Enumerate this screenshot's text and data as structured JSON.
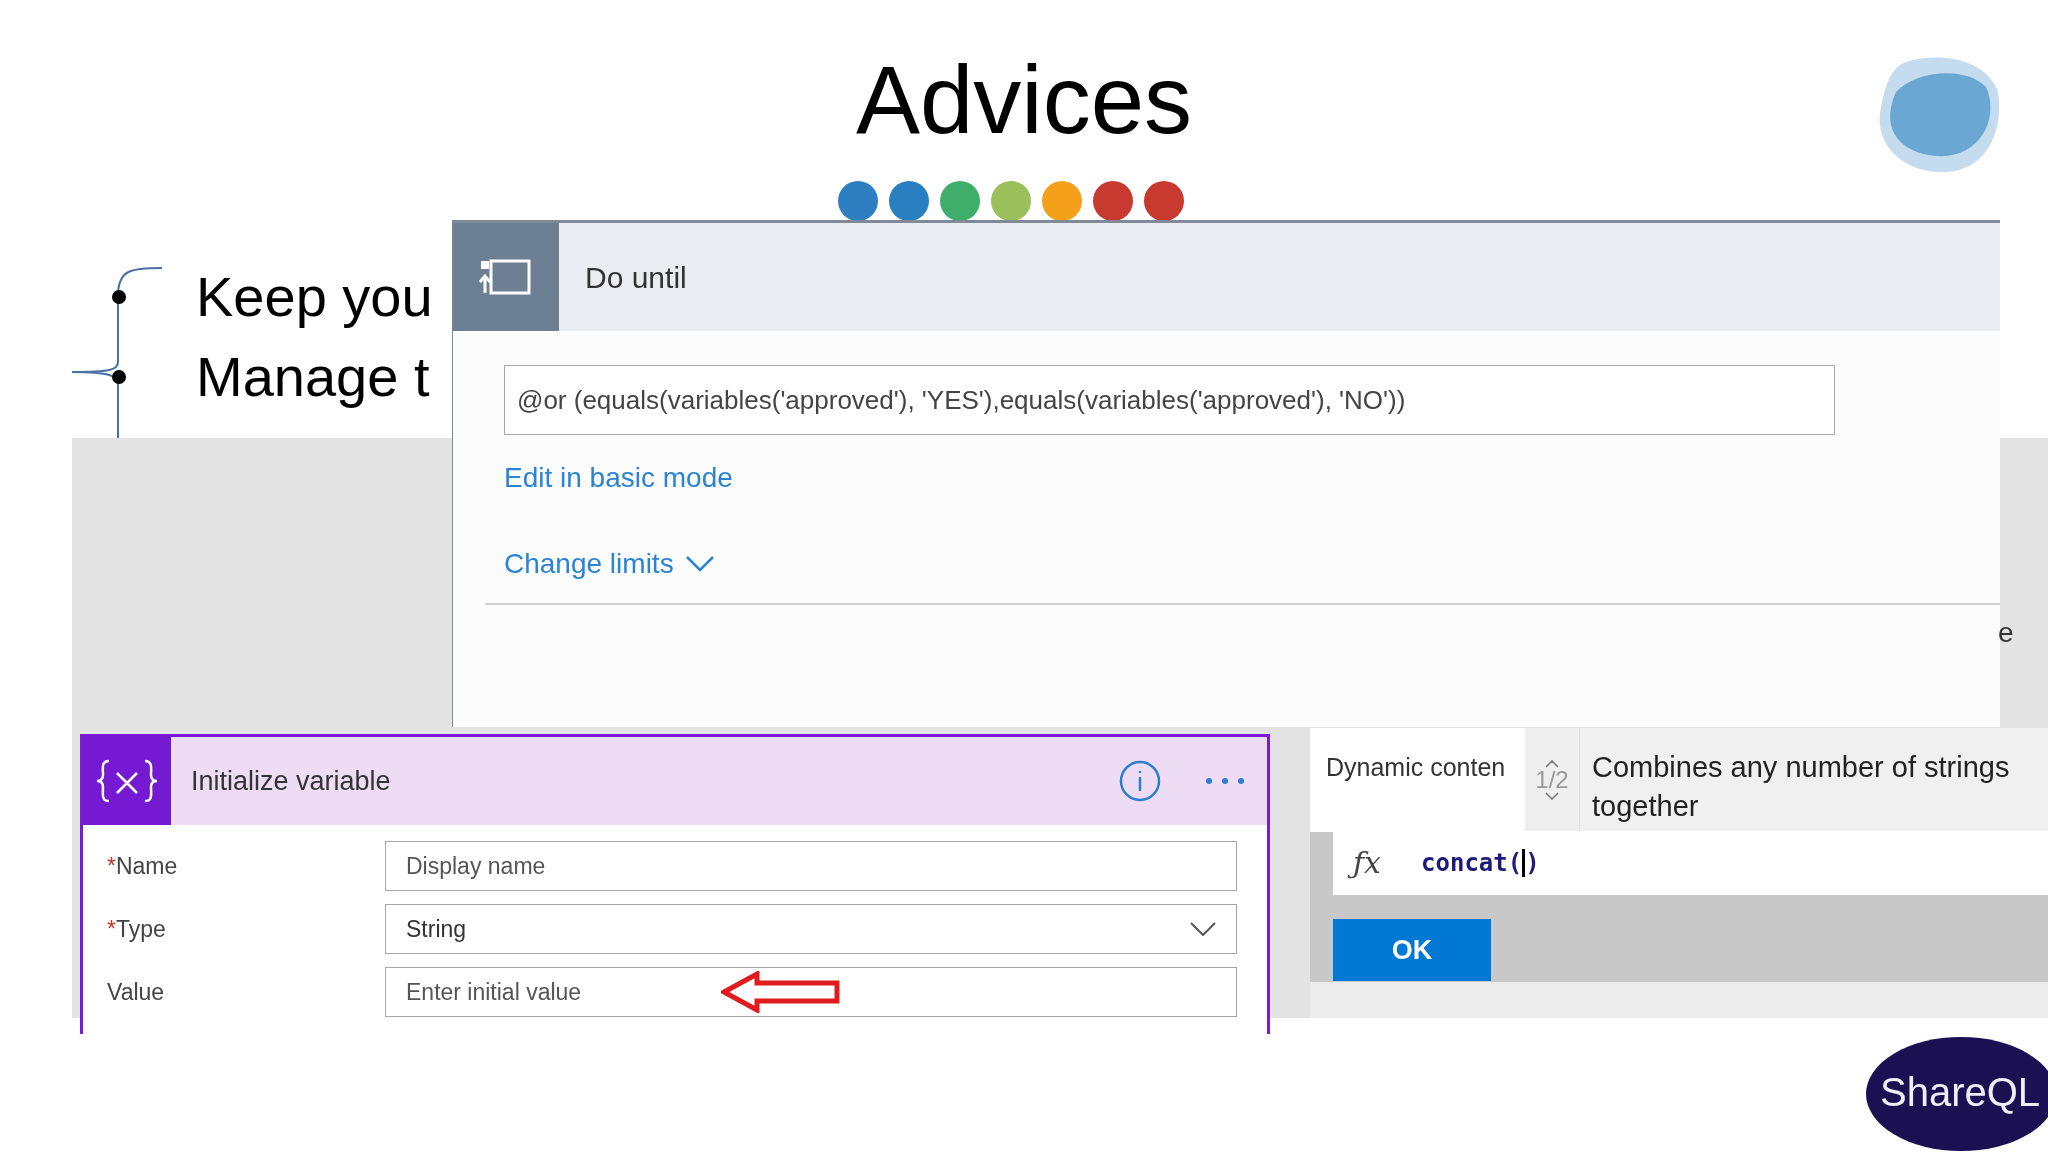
{
  "slide": {
    "title": "Advices",
    "dots": [
      {
        "color": "#2e7fc1"
      },
      {
        "color": "#2a7fc0"
      },
      {
        "color": "#3fae6a"
      },
      {
        "color": "#9bbf5a"
      },
      {
        "color": "#f5a01a"
      },
      {
        "color": "#c8392f"
      },
      {
        "color": "#c8392f"
      }
    ],
    "bullets": [
      "Keep you",
      "Manage t"
    ],
    "logo": "ShareQL"
  },
  "do_until": {
    "title": "Do until",
    "expression": "@or (equals(variables('approved'), 'YES'),equals(variables('approved'), 'NO'))",
    "edit_link": "Edit in basic mode",
    "change_limits": "Change limits",
    "partial_text": "e"
  },
  "initialize_variable": {
    "title": "Initialize variable",
    "required_mark": "*",
    "fields": [
      {
        "label": "Name",
        "required": true,
        "kind": "text",
        "placeholder": "Display name"
      },
      {
        "label": "Type",
        "required": true,
        "kind": "dropdown",
        "value": "String"
      },
      {
        "label": "Value",
        "required": false,
        "kind": "text",
        "placeholder": "Enter initial value",
        "arrow": true
      }
    ]
  },
  "expression_editor": {
    "tab": "Dynamic conten",
    "counter": "1/2",
    "description": "Combines any number of strings together",
    "formula_icon": "ƒx",
    "formula": "concat(",
    "formula_close": ")",
    "ok": "OK"
  }
}
